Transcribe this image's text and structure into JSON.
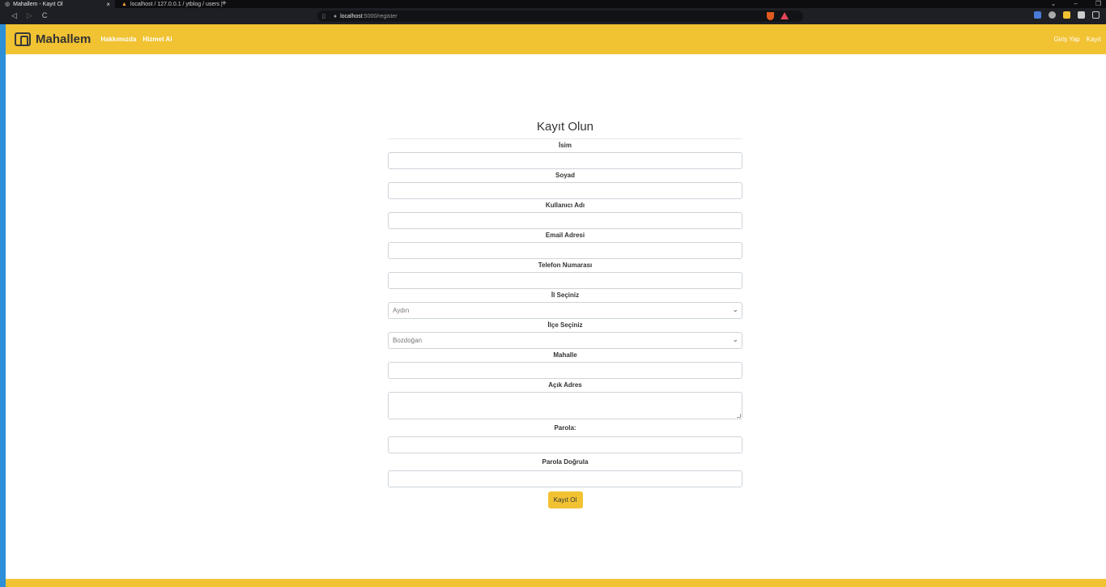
{
  "browser": {
    "tabs": [
      {
        "title": "Mahallem - Kayıt Ol",
        "close": "×"
      },
      {
        "title": "localhost / 127.0.0.1 / ytblog / users | ",
        "close": ""
      }
    ],
    "new_tab": "+",
    "window_controls": [
      "⌄",
      "–",
      "❐"
    ],
    "nav": [
      "◁",
      "▷",
      "C"
    ],
    "url_host": "localhost",
    "url_rest": ":5000/register",
    "address_icons": [
      "bookmark-icon",
      "info-icon"
    ]
  },
  "navbar": {
    "brand": "Mahallem",
    "links": [
      "Hakkımızda",
      "Hizmet Al"
    ],
    "right_links": [
      "Giriş Yap",
      "Kayıt"
    ]
  },
  "form": {
    "title": "Kayıt Olun",
    "fields": [
      {
        "label": "İsim",
        "type": "text",
        "value": ""
      },
      {
        "label": "Soyad",
        "type": "text",
        "value": ""
      },
      {
        "label": "Kullanıcı Adı",
        "type": "text",
        "value": ""
      },
      {
        "label": "Email Adresi",
        "type": "text",
        "value": ""
      },
      {
        "label": "Telefon Numarası",
        "type": "text",
        "value": ""
      },
      {
        "label": "İl Seçiniz",
        "type": "select",
        "value": "Aydın"
      },
      {
        "label": "İlçe Seçiniz",
        "type": "select",
        "value": "Bozdoğan"
      },
      {
        "label": "Mahalle",
        "type": "text",
        "value": ""
      },
      {
        "label": "Açık Adres",
        "type": "textarea",
        "value": ""
      },
      {
        "label": "Parola:",
        "type": "password",
        "value": ""
      },
      {
        "label": "Parola Doğrula",
        "type": "password",
        "value": ""
      }
    ],
    "submit_label": "Kayıt Ol"
  },
  "colors": {
    "brand_yellow": "#f1c232",
    "frame_blue": "#2d8fd8",
    "browser_dark": "#1e1f24"
  }
}
